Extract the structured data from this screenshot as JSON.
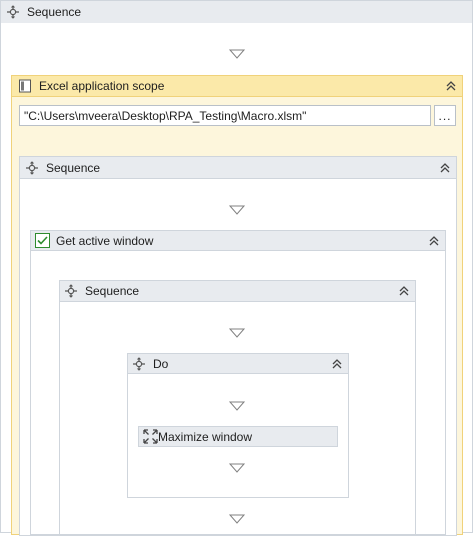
{
  "root": {
    "title": "Sequence",
    "icon": "sequence-icon"
  },
  "excel_scope": {
    "title": "Excel application scope",
    "icon": "excel-scope-icon",
    "file_path": "\"C:\\Users\\mveera\\Desktop\\RPA_Testing\\Macro.xlsm\"",
    "browse_label": "..."
  },
  "sequence_1": {
    "title": "Sequence",
    "icon": "sequence-icon"
  },
  "get_active_window": {
    "title": "Get active window",
    "icon": "checkbox-window-icon"
  },
  "sequence_2": {
    "title": "Sequence",
    "icon": "sequence-icon"
  },
  "do_block": {
    "title": "Do",
    "icon": "sequence-icon"
  },
  "maximize_window": {
    "title": "Maximize window",
    "icon": "maximize-icon"
  },
  "colors": {
    "header_gray": "#e8ebef",
    "border_gray": "#cfd5dc",
    "excel_header": "#fbe9a9",
    "excel_border": "#f0d27a",
    "check_green": "#2e8b2e"
  }
}
